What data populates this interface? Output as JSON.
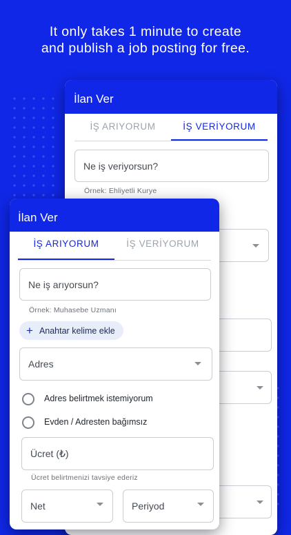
{
  "headline": {
    "line1": "It only takes 1 minute to create",
    "line2": "and publish a job posting for free."
  },
  "back_card": {
    "title": "İlan Ver",
    "tabs": [
      {
        "label": "İŞ ARIYORUM",
        "active": false
      },
      {
        "label": "İŞ VERİYORUM",
        "active": true
      }
    ],
    "position_input": {
      "placeholder": "Ne iş veriyorsun?"
    },
    "position_helper": "Örnek: Ehliyetli Kurye"
  },
  "front_card": {
    "title": "İlan Ver",
    "tabs": [
      {
        "label": "İŞ ARIYORUM",
        "active": true
      },
      {
        "label": "İŞ VERİYORUM",
        "active": false
      }
    ],
    "position_input": {
      "placeholder": "Ne iş arıyorsun?"
    },
    "position_helper": "Örnek: Muhasebe Uzmanı",
    "keyword_chip": "Anahtar kelime ekle",
    "address_select": "Adres",
    "radio_options": [
      {
        "label": "Adres belirtmek istemiyorum",
        "checked": false
      },
      {
        "label": "Evden / Adresten bağımsız",
        "checked": false
      }
    ],
    "salary_input": {
      "placeholder": "Ücret (₺)"
    },
    "salary_helper": "Ücret belirtmenizi tavsiye ederiz",
    "net_select": "Net",
    "period_select": "Periyod"
  },
  "colors": {
    "brand_blue": "#1027e8",
    "field_border": "#c9cdd2",
    "chip_bg": "#e8eef9"
  }
}
